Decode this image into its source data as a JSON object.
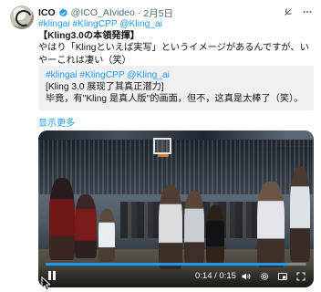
{
  "author": {
    "name": "ICO",
    "handle": "@ICO_AIvideo",
    "separator": "·",
    "date": "2月5日"
  },
  "tweet": {
    "line1_tags": "#klingai #KlingCPP @Kling_ai",
    "line2": "【Kling3.0の本領発揮】",
    "line3": "やはり「Klingといえば実写」というイメージがあるんですが、いやーこれは凄い（笑）"
  },
  "quote": {
    "tags": "#klingai #KlingCPP @Kling_ai",
    "line1": "[Kling 3.0 展现了其真正潜力]",
    "line2": "毕竟，有\"Kling 是真人版\"的画面，但不，这真是太棒了（笑）。"
  },
  "show_more": "显示更多",
  "video": {
    "time": "0:14 / 0:15",
    "progress": 0.93,
    "accent": "#1d9bf0"
  },
  "icons": {
    "verified": "verified-badge-icon",
    "grok": "grok-icon",
    "more": "more-dots-icon"
  }
}
